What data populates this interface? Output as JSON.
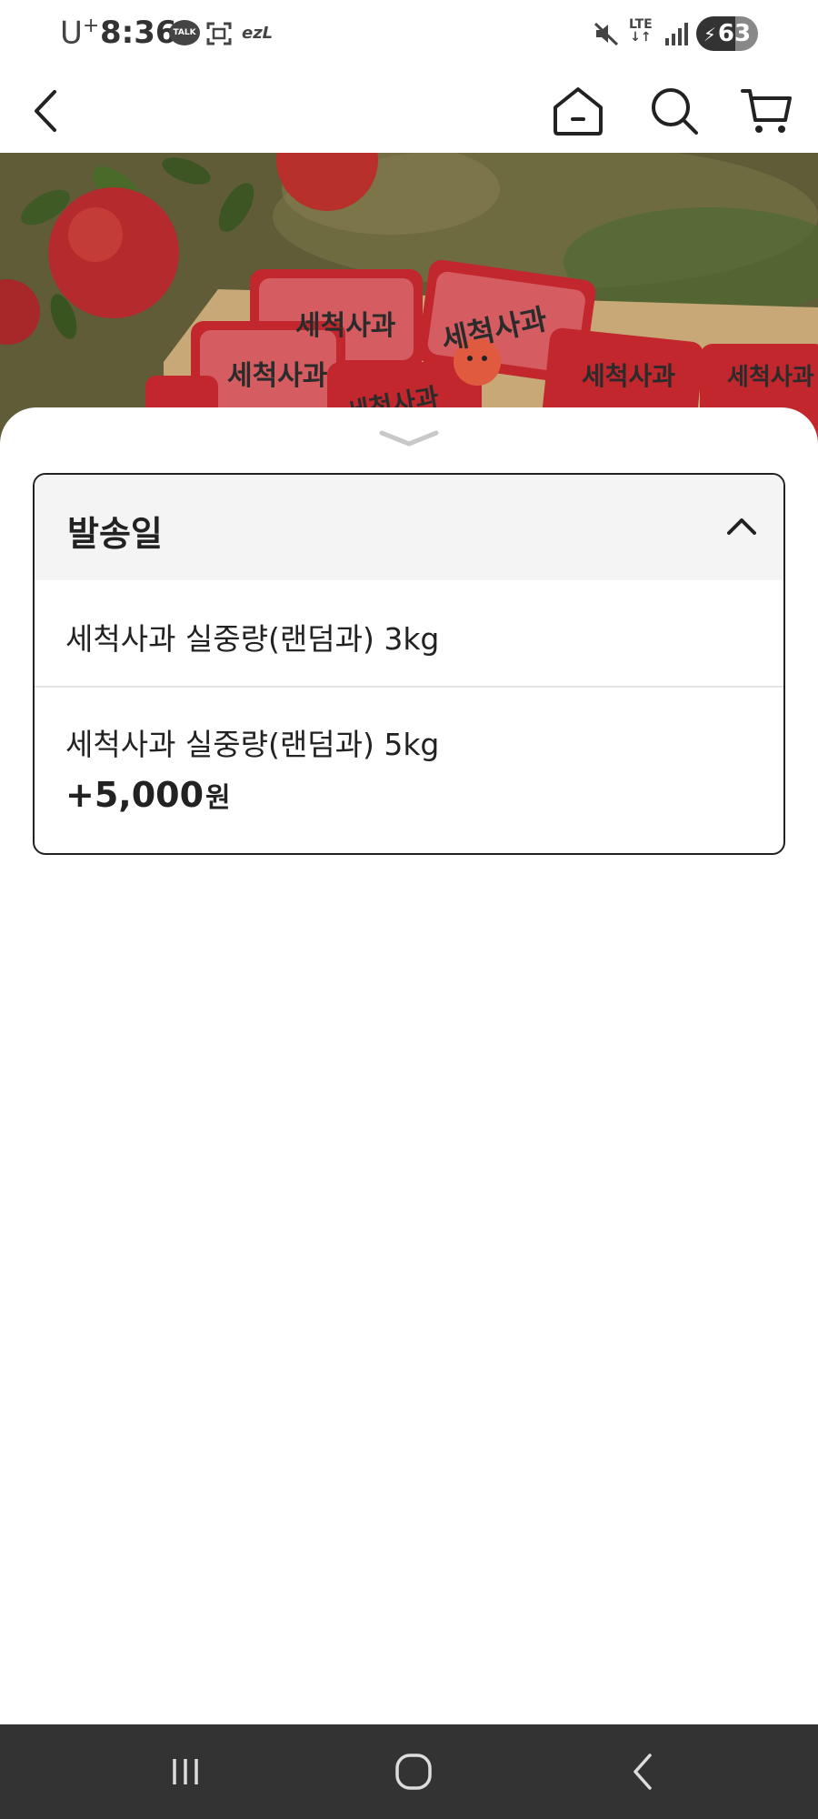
{
  "status_bar": {
    "carrier": "U",
    "carrier_sup": "+",
    "time": "8:36",
    "talk_badge": "TALK",
    "ezl": "ezL",
    "lte_top": "LTE",
    "lte_bottom": "↓↑",
    "battery_level": "63",
    "icons": [
      "talk-icon",
      "scan-icon",
      "ezl-icon",
      "mute-icon",
      "lte-icon",
      "signal-icon",
      "battery-charging-icon"
    ]
  },
  "header": {
    "icons": [
      "back-icon",
      "home-icon",
      "search-icon",
      "cart-icon"
    ]
  },
  "product": {
    "image_text": "세척사과"
  },
  "option_panel": {
    "title": "발송일",
    "items": [
      {
        "name": "세척사과 실중량(랜덤과) 3kg"
      },
      {
        "name": "세척사과 실중량(랜덤과) 5kg",
        "price": "+5,000",
        "currency": "원"
      }
    ]
  },
  "nav_bar": {
    "icons": [
      "recents-icon",
      "home-circle-icon",
      "nav-back-icon"
    ]
  },
  "colors": {
    "nav_bg": "#333333",
    "option_header_bg": "#f4f4f4",
    "apple_red": "#c2272d"
  }
}
